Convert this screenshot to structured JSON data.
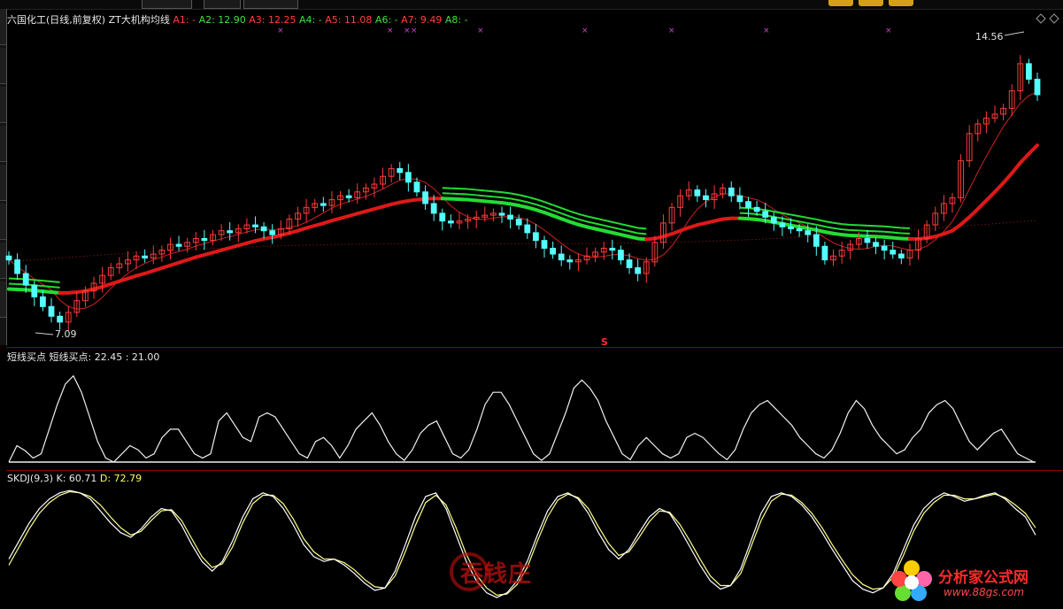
{
  "header": {
    "title": "六国化工(日线,前复权)",
    "indicator_name": "ZT大机构均线",
    "params": [
      {
        "label": "A1: -",
        "color": "red"
      },
      {
        "label": "A2: 12.90",
        "color": "green"
      },
      {
        "label": "A3: 12.25",
        "color": "red"
      },
      {
        "label": "A4: -",
        "color": "green"
      },
      {
        "label": "A5: 11.08",
        "color": "red"
      },
      {
        "label": "A6: -",
        "color": "green"
      },
      {
        "label": "A7: 9.49",
        "color": "red"
      },
      {
        "label": "A8: -",
        "color": "green"
      }
    ]
  },
  "mid_panel": {
    "name": "短线买点",
    "values_text": "短线买点: 22.45 : 21.00"
  },
  "low_panel": {
    "name": "SKDJ(9,3)",
    "k_text": "K: 60.71",
    "d_text": "D: 72.79"
  },
  "annotations": {
    "high_label": "14.56",
    "low_label": "7.09",
    "signal_mark": "S"
  },
  "watermarks": {
    "left_brand": "吞钱庄",
    "site_name": "分析家公式网",
    "site_url": "www.88gs.com"
  },
  "colors": {
    "background": "#000000",
    "up_candle": "#ff3b3b",
    "down_candle": "#54ffff",
    "ma_thick": "#e01818",
    "ma_green": "#22dd33",
    "kdj_k": "#ffffff",
    "kdj_d": "#ffff88"
  },
  "chart_data": [
    {
      "type": "candlestick",
      "title": "六国化工(日线,前复权)",
      "y_markers": {
        "high": 14.56,
        "low": 7.09
      },
      "closes": [
        8.95,
        8.6,
        8.3,
        8.0,
        7.75,
        7.5,
        7.35,
        7.6,
        7.9,
        8.15,
        8.35,
        8.55,
        8.75,
        8.85,
        8.95,
        9.05,
        9.0,
        9.1,
        9.2,
        9.35,
        9.3,
        9.4,
        9.5,
        9.45,
        9.6,
        9.7,
        9.65,
        9.75,
        9.85,
        9.8,
        9.7,
        9.6,
        9.75,
        10.0,
        10.15,
        10.3,
        10.4,
        10.35,
        10.5,
        10.6,
        10.55,
        10.7,
        10.8,
        10.9,
        11.1,
        11.3,
        11.2,
        10.95,
        10.7,
        10.4,
        10.15,
        9.95,
        9.9,
        9.95,
        10.0,
        10.05,
        10.1,
        10.15,
        10.1,
        10.0,
        9.85,
        9.65,
        9.45,
        9.25,
        9.1,
        8.95,
        8.9,
        8.95,
        9.05,
        9.15,
        9.25,
        9.2,
        8.95,
        8.75,
        8.6,
        8.9,
        9.4,
        9.9,
        10.3,
        10.6,
        10.75,
        10.6,
        10.5,
        10.65,
        10.8,
        10.6,
        10.45,
        10.3,
        10.2,
        10.05,
        9.9,
        9.8,
        9.75,
        9.7,
        9.6,
        9.3,
        8.95,
        9.05,
        9.2,
        9.35,
        9.5,
        9.4,
        9.3,
        9.2,
        9.1,
        9.0,
        9.2,
        9.5,
        9.85,
        10.15,
        10.4,
        10.55,
        11.5,
        12.2,
        12.45,
        12.6,
        12.7,
        12.85,
        13.3,
        14.0,
        13.6,
        13.2
      ],
      "series_ma": [
        {
          "values_note": "ma-thick",
          "values": [
            8.2,
            8.19,
            8.18,
            8.16,
            8.14,
            8.12,
            8.1,
            8.1,
            8.12,
            8.15,
            8.2,
            8.26,
            8.33,
            8.4,
            8.47,
            8.54,
            8.6,
            8.67,
            8.74,
            8.81,
            8.88,
            8.95,
            9.02,
            9.08,
            9.14,
            9.2,
            9.26,
            9.32,
            9.38,
            9.44,
            9.49,
            9.53,
            9.58,
            9.64,
            9.7,
            9.77,
            9.83,
            9.89,
            9.96,
            10.02,
            10.08,
            10.14,
            10.2,
            10.26,
            10.32,
            10.38,
            10.43,
            10.47,
            10.5,
            10.52,
            10.53,
            10.53,
            10.52,
            10.51,
            10.5,
            10.48,
            10.46,
            10.44,
            10.42,
            10.39,
            10.35,
            10.3,
            10.24,
            10.17,
            10.09,
            10.01,
            9.93,
            9.86,
            9.8,
            9.75,
            9.7,
            9.65,
            9.6,
            9.55,
            9.5,
            9.48,
            9.5,
            9.55,
            9.62,
            9.7,
            9.78,
            9.85,
            9.9,
            9.95,
            10.0,
            10.02,
            10.02,
            10.01,
            9.99,
            9.96,
            9.92,
            9.88,
            9.84,
            9.8,
            9.76,
            9.72,
            9.67,
            9.63,
            9.6,
            9.58,
            9.57,
            9.56,
            9.55,
            9.54,
            9.52,
            9.5,
            9.49,
            9.49,
            9.51,
            9.55,
            9.62,
            9.7,
            9.86,
            10.05,
            10.26,
            10.48,
            10.7,
            10.93,
            11.18,
            11.45,
            11.68,
            11.9
          ]
        }
      ]
    },
    {
      "type": "line",
      "title": "短线买点",
      "series": [
        {
          "name": "短线买点",
          "values": [
            0,
            20,
            14,
            5,
            10,
            40,
            70,
            95,
            105,
            85,
            55,
            25,
            5,
            0,
            10,
            20,
            15,
            5,
            10,
            30,
            40,
            40,
            25,
            10,
            5,
            10,
            50,
            60,
            45,
            30,
            25,
            55,
            60,
            55,
            40,
            25,
            10,
            5,
            25,
            30,
            20,
            5,
            20,
            40,
            50,
            60,
            45,
            25,
            10,
            2,
            15,
            35,
            45,
            50,
            30,
            10,
            5,
            15,
            40,
            70,
            85,
            85,
            70,
            50,
            30,
            10,
            2,
            10,
            35,
            60,
            90,
            100,
            90,
            75,
            50,
            30,
            10,
            3,
            20,
            30,
            20,
            10,
            5,
            10,
            30,
            35,
            30,
            20,
            10,
            3,
            15,
            40,
            60,
            70,
            75,
            65,
            55,
            45,
            30,
            20,
            10,
            5,
            15,
            35,
            60,
            75,
            65,
            45,
            30,
            20,
            10,
            15,
            30,
            40,
            60,
            70,
            75,
            65,
            45,
            25,
            15,
            25,
            35,
            40,
            25,
            10,
            5,
            0
          ]
        }
      ]
    },
    {
      "type": "line",
      "title": "SKDJ(9,3)",
      "series": [
        {
          "name": "K",
          "values": [
            40,
            55,
            70,
            82,
            90,
            95,
            97,
            95,
            90,
            80,
            70,
            62,
            58,
            65,
            75,
            82,
            80,
            68,
            52,
            38,
            30,
            38,
            55,
            75,
            90,
            95,
            92,
            82,
            68,
            52,
            42,
            38,
            40,
            35,
            28,
            20,
            14,
            16,
            30,
            52,
            75,
            92,
            95,
            82,
            60,
            38,
            22,
            12,
            8,
            12,
            22,
            38,
            60,
            80,
            92,
            95,
            90,
            78,
            62,
            48,
            40,
            48,
            62,
            75,
            82,
            78,
            65,
            50,
            35,
            22,
            15,
            18,
            32,
            55,
            78,
            92,
            95,
            92,
            85,
            75,
            62,
            48,
            35,
            22,
            15,
            12,
            16,
            28,
            48,
            68,
            82,
            90,
            95,
            92,
            88,
            90,
            93,
            95,
            90,
            82,
            75,
            60
          ]
        },
        {
          "name": "D",
          "values": [
            35,
            50,
            65,
            78,
            87,
            93,
            96,
            95,
            92,
            85,
            75,
            66,
            60,
            63,
            72,
            80,
            81,
            72,
            57,
            42,
            33,
            36,
            50,
            70,
            86,
            93,
            93,
            86,
            73,
            57,
            46,
            40,
            40,
            37,
            31,
            23,
            17,
            16,
            26,
            46,
            68,
            87,
            93,
            85,
            66,
            44,
            27,
            16,
            10,
            11,
            19,
            33,
            55,
            75,
            89,
            94,
            91,
            82,
            67,
            53,
            43,
            46,
            58,
            71,
            80,
            79,
            69,
            55,
            40,
            26,
            18,
            18,
            28,
            50,
            72,
            88,
            94,
            93,
            87,
            78,
            66,
            52,
            39,
            27,
            19,
            15,
            16,
            25,
            43,
            63,
            78,
            87,
            93,
            93,
            90,
            90,
            92,
            94,
            91,
            85,
            78,
            66
          ]
        }
      ]
    }
  ]
}
